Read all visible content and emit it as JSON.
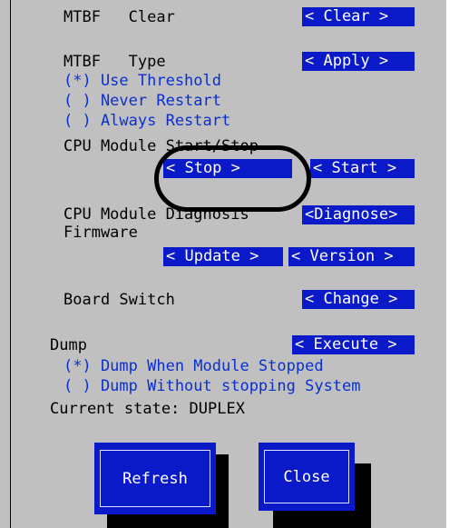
{
  "mtbf_clear": {
    "label": "MTBF   Clear",
    "button": "< Clear >"
  },
  "mtbf_type": {
    "label": "MTBF   Type",
    "button": "< Apply >",
    "options": [
      "(*) Use Threshold",
      "( ) Never Restart",
      "( ) Always Restart"
    ]
  },
  "cpu_start_stop": {
    "label": "CPU Module Start/Stop",
    "stop_button": "< Stop >",
    "start_button": "< Start >"
  },
  "cpu_diagnosis": {
    "label": "CPU Module Diagnosis",
    "button": "<Diagnose>"
  },
  "firmware": {
    "label": "Firmware",
    "update_button": "< Update >",
    "version_button": "< Version >"
  },
  "board_switch": {
    "label": "Board Switch",
    "button": "< Change >"
  },
  "dump": {
    "label": "Dump",
    "button": "< Execute >",
    "options": [
      "(*) Dump When Module Stopped",
      "( ) Dump Without stopping System"
    ]
  },
  "current_state": "Current state: DUPLEX",
  "footer": {
    "refresh": "Refresh",
    "close": "Close"
  },
  "colors": {
    "background": "#c0c0c0",
    "button": "#0a1ac8",
    "option_text": "#0a2fd0"
  }
}
